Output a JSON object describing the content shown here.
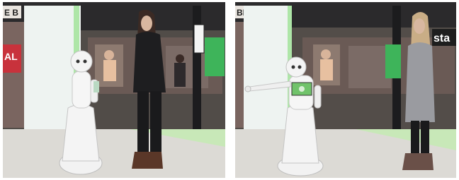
{
  "panels": [
    {
      "id": "left",
      "signs": {
        "store_sign": "AL",
        "edge_sign": "E B"
      }
    },
    {
      "id": "right",
      "signs": {
        "store_sign": "sta",
        "edge_sign": "BE"
      }
    }
  ]
}
